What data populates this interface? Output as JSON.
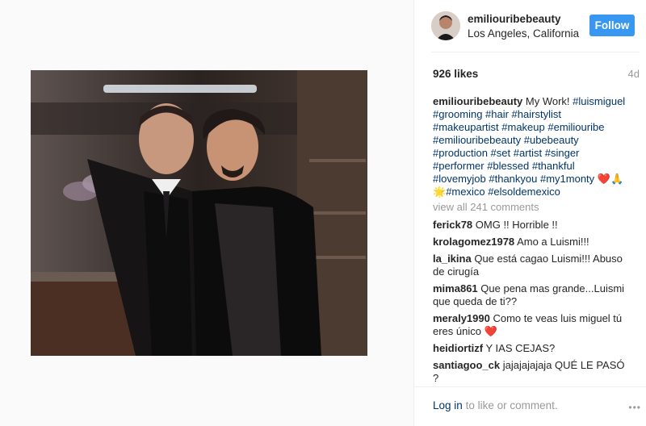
{
  "post": {
    "username": "emiliouribebeauty",
    "location": "Los Angeles, California",
    "follow_label": "Follow",
    "likes": "926 likes",
    "age": "4d",
    "caption_username": "emiliouribebeauty",
    "caption_text_1": "My Work!",
    "hashtags_line_1": "#luismiguel",
    "hashtags_line_2": "#grooming #hair #hairstylist",
    "hashtags_line_3": "#makeupartist #makeup #emiliouribe",
    "hashtags_line_4": "#emiliouribebeauty #ubebeauty",
    "hashtags_line_5": "#production #set #artist #singer",
    "hashtags_line_6": "#performer #blessed #thankful",
    "hashtags_line_7": "#lovemyjob #thankyou #my1monty",
    "emoji_line_7": "❤️🙏",
    "emoji_line_8": "🌟",
    "hashtags_line_8": "#mexico #elsoldemexico",
    "view_all": "view all 241 comments",
    "comments": [
      {
        "user": "ferick78",
        "text": "OMG !! Horrible !!"
      },
      {
        "user": "krolagomez1978",
        "text": "Amo a Luismi!!!"
      },
      {
        "user": "la_ikina",
        "text": "Que está cagao Luismi!!! Abuso de cirugía"
      },
      {
        "user": "mima861",
        "text": "Que pena mas grande...Luismi que queda de ti??"
      },
      {
        "user": "meraly1990",
        "text": "Como te veas luis miguel tú eres único",
        "emoji": "❤️"
      },
      {
        "user": "heidiortizf",
        "text": "Y IAS CEJAS?"
      },
      {
        "user": "santiagoo_ck",
        "text": "jajajajajaja QUÉ LE PASÓ ?"
      }
    ],
    "login_link": "Log in",
    "login_text": "to like or comment.",
    "more_icon": "•••"
  },
  "icons": {
    "more": "more-options-icon"
  },
  "colors": {
    "follow_bg": "#3897f0",
    "link": "#003569",
    "muted": "#999999",
    "heart": "#e0245e"
  }
}
